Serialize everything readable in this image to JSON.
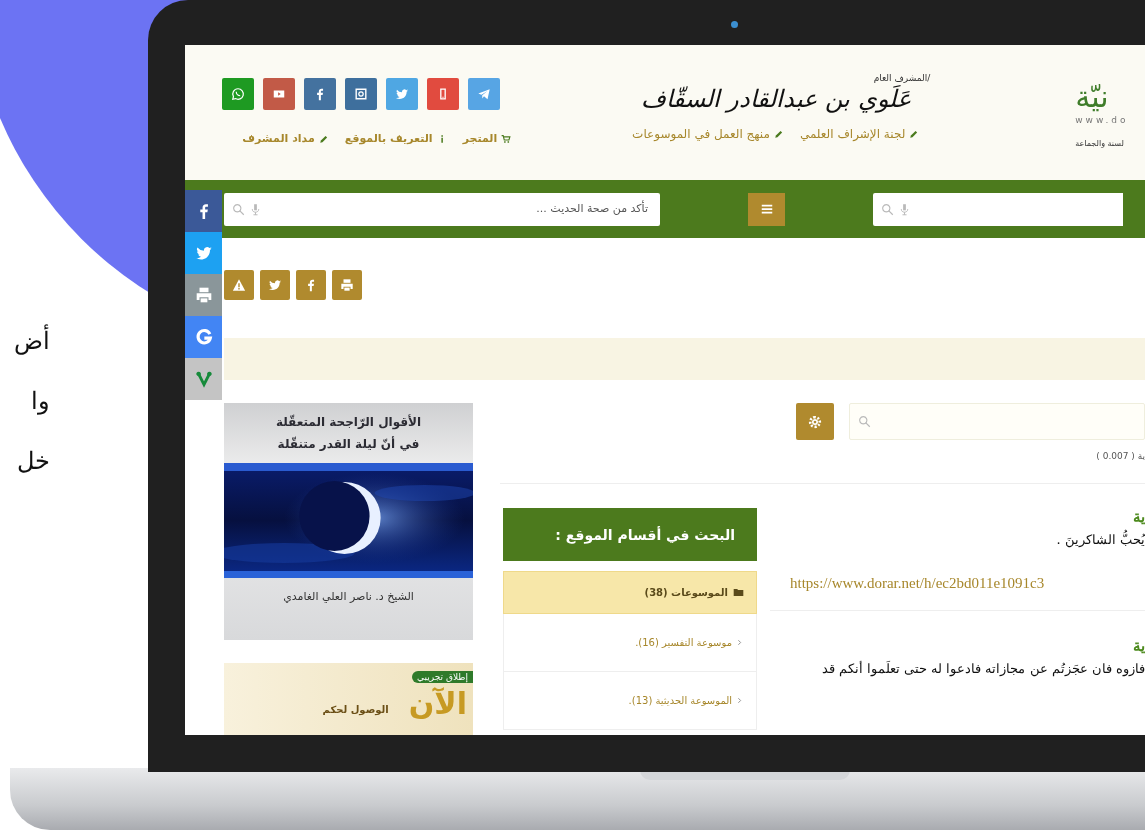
{
  "backdrop_lines": [
    "أض",
    "وا",
    "خل"
  ],
  "header": {
    "social": [
      {
        "kind": "whatsapp"
      },
      {
        "kind": "youtube"
      },
      {
        "kind": "facebook"
      },
      {
        "kind": "instagram"
      },
      {
        "kind": "twitter"
      },
      {
        "kind": "mobile"
      },
      {
        "kind": "telegram"
      }
    ],
    "links": [
      {
        "kind": "cart",
        "label": "المتجر"
      },
      {
        "kind": "info",
        "label": "التعريف بالموقع"
      },
      {
        "kind": "pencil",
        "label": "مداد المشرف"
      }
    ],
    "supervisor_label": "المشرف العام/",
    "supervisor_name": "عَلَوي بن عبدالقادر السقّاف",
    "center_links": [
      {
        "kind": "pencil",
        "label": "لجنة الإشراف العلمي"
      },
      {
        "kind": "pencil",
        "label": "منهج العمل في الموسوعات"
      }
    ],
    "logo": {
      "mark": "نيّة",
      "site": "www.do",
      "tagline": "لسنة والجماعة"
    }
  },
  "search_bar": {
    "placeholder": "تأكد من صحة الحديث ..."
  },
  "side_share": [
    {
      "kind": "facebook"
    },
    {
      "kind": "twitter"
    },
    {
      "kind": "print"
    },
    {
      "kind": "google"
    },
    {
      "kind": "vine"
    }
  ],
  "page_tools": [
    {
      "kind": "alert"
    },
    {
      "kind": "twitter"
    },
    {
      "kind": "facebook"
    },
    {
      "kind": "print"
    }
  ],
  "search_timing": "ية ( 0.007 )",
  "book_ad": {
    "title_lines": [
      "الأقوال الرّاجحة المتعقّلة",
      "في أنّ ليلة القدر متنقّلة"
    ],
    "author": "الشيخ د. ناصر العلي الغامدي"
  },
  "promo_ad": {
    "badge": "إطلاق تجريبي",
    "headline": "الآن",
    "text": "الوصول لحكم"
  },
  "sections": {
    "title": "البحث في أقسام الموقع :",
    "items": [
      {
        "kind": "category",
        "label": "الموسوعات (38)"
      },
      {
        "kind": "subitem",
        "label": "موسوعة التفسير (16)."
      },
      {
        "kind": "subitem",
        "label": "الموسوعة الحديثية (13)."
      }
    ]
  },
  "results": [
    {
      "heading": "ية",
      "text": "يُحبُّ الشاكرينَ .",
      "link": "https://www.dorar.net/h/ec2bd011e1091c3"
    },
    {
      "heading": "ية",
      "text": "فازوه فان عجَزتُم عن مجازاته فادعوا له حتى تعلَموا أنكم قد"
    }
  ]
}
